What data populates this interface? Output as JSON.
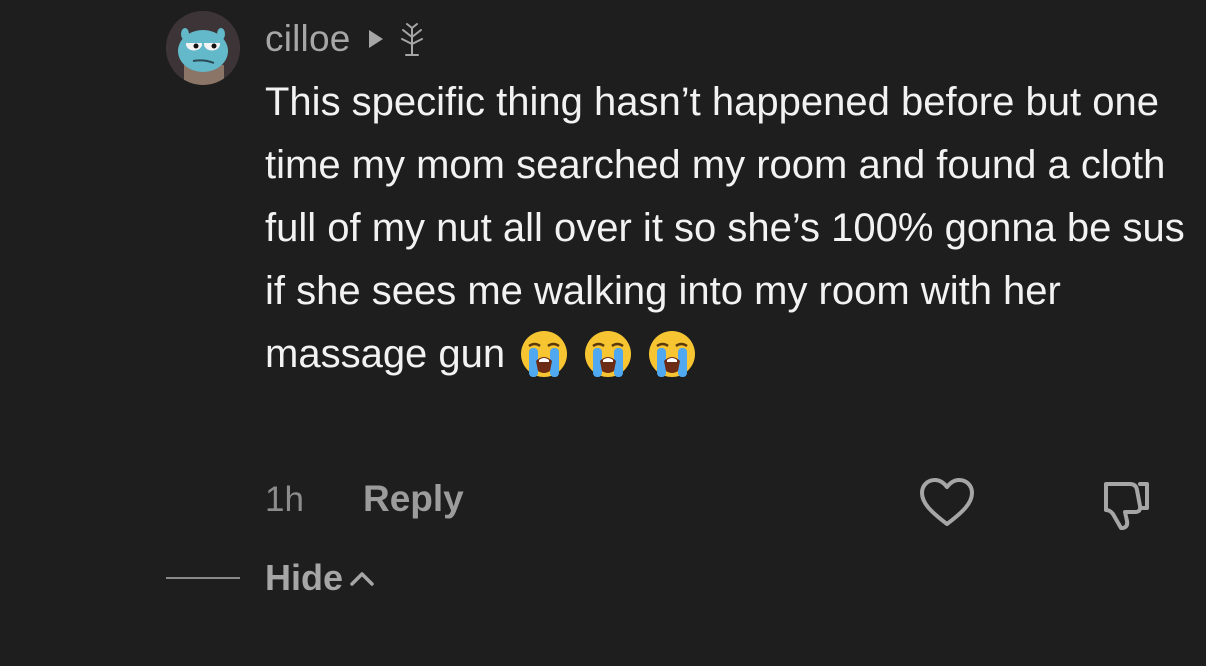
{
  "comment": {
    "username": "cilloe",
    "body_text": "This specific thing hasn’t happened before but one time my mom searched my room and found a cloth full of my nut all over it so she’s 100% gonna be sus if she sees me walking into my room with her massage gun",
    "emojis": [
      "😭",
      "😭",
      "😭"
    ],
    "timestamp": "1h",
    "reply_label": "Reply",
    "hide_label": "Hide"
  },
  "icons": {
    "reply_arrow": "triangle-right-icon",
    "replied_to": "tree-branch-icon",
    "like": "heart-outline-icon",
    "dislike": "thumbs-down-icon",
    "collapse": "chevron-up-icon",
    "emoji": "loudly-crying-face-icon"
  },
  "colors": {
    "background": "#1e1e1e",
    "text_primary": "#f2f2f2",
    "text_secondary": "#a6a6a6"
  }
}
